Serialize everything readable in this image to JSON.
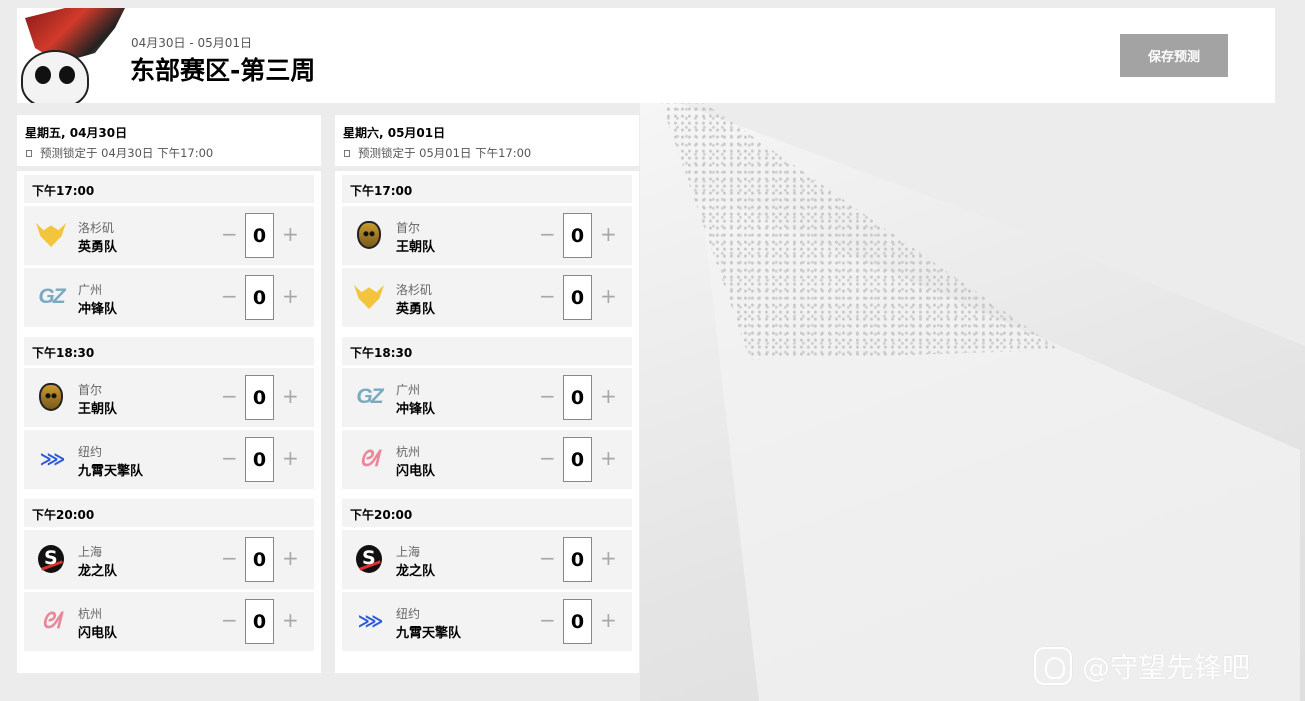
{
  "header": {
    "date_range": "04月30日 - 05月01日",
    "title": "东部赛区-第三周",
    "save_button": "保存预测"
  },
  "days": [
    {
      "title": "星期五, 04月30日",
      "lock_text": "预测锁定于 04月30日 下午17:00",
      "slots": [
        {
          "time": "下午17:00",
          "teams": [
            {
              "logo": "la-valiant-icon",
              "city": "洛杉矶",
              "name": "英勇队",
              "score": "0"
            },
            {
              "logo": "guangzhou-charge-icon",
              "city": "广州",
              "name": "冲锋队",
              "score": "0"
            }
          ]
        },
        {
          "time": "下午18:30",
          "teams": [
            {
              "logo": "seoul-dynasty-icon",
              "city": "首尔",
              "name": "王朝队",
              "score": "0"
            },
            {
              "logo": "nyxl-icon",
              "city": "纽约",
              "name": "九霄天擎队",
              "score": "0"
            }
          ]
        },
        {
          "time": "下午20:00",
          "teams": [
            {
              "logo": "shanghai-dragons-icon",
              "city": "上海",
              "name": "龙之队",
              "score": "0"
            },
            {
              "logo": "hangzhou-spark-icon",
              "city": "杭州",
              "name": "闪电队",
              "score": "0"
            }
          ]
        }
      ]
    },
    {
      "title": "星期六, 05月01日",
      "lock_text": "预测锁定于 05月01日 下午17:00",
      "slots": [
        {
          "time": "下午17:00",
          "teams": [
            {
              "logo": "seoul-dynasty-icon",
              "city": "首尔",
              "name": "王朝队",
              "score": "0"
            },
            {
              "logo": "la-valiant-icon",
              "city": "洛杉矶",
              "name": "英勇队",
              "score": "0"
            }
          ]
        },
        {
          "time": "下午18:30",
          "teams": [
            {
              "logo": "guangzhou-charge-icon",
              "city": "广州",
              "name": "冲锋队",
              "score": "0"
            },
            {
              "logo": "hangzhou-spark-icon",
              "city": "杭州",
              "name": "闪电队",
              "score": "0"
            }
          ]
        },
        {
          "time": "下午20:00",
          "teams": [
            {
              "logo": "shanghai-dragons-icon",
              "city": "上海",
              "name": "龙之队",
              "score": "0"
            },
            {
              "logo": "nyxl-icon",
              "city": "纽约",
              "name": "九霄天擎队",
              "score": "0"
            }
          ]
        }
      ]
    }
  ],
  "controls": {
    "minus": "−",
    "plus": "+"
  },
  "logo_glyphs": {
    "guangzhou": "GZ",
    "nyxl": "⋙",
    "hangzhou": "ᘛ"
  },
  "watermark": "@守望先锋吧",
  "colors": {
    "save_button": "#a3a3a3",
    "row_bg": "#f3f3f3",
    "page_bg": "#ececec"
  }
}
